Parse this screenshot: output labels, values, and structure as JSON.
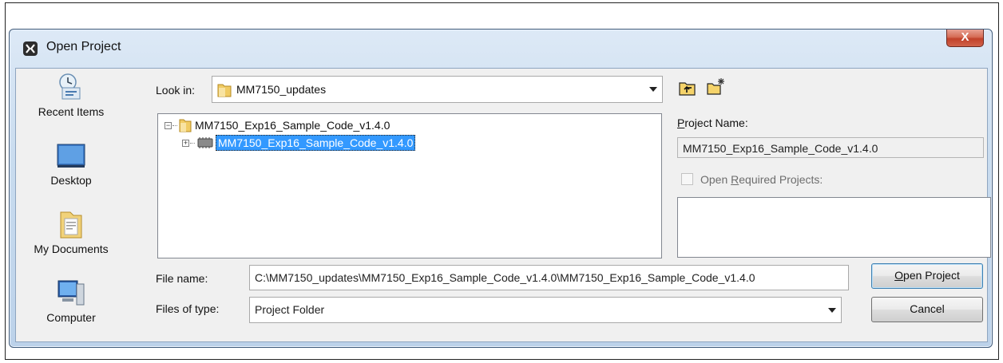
{
  "dialog": {
    "title": "Open Project",
    "close_glyph": "X",
    "accent_color": "#3399ff",
    "close_color": "#c1412a"
  },
  "places": [
    {
      "label": "Recent Items",
      "icon": "recent-items-icon"
    },
    {
      "label": "Desktop",
      "icon": "desktop-icon"
    },
    {
      "label": "My Documents",
      "icon": "my-documents-icon"
    },
    {
      "label": "Computer",
      "icon": "computer-icon"
    }
  ],
  "look_in": {
    "label": "Look in:",
    "value": "MM7150_updates"
  },
  "toolbar": {
    "up_folder_icon": "up-one-level-icon",
    "new_folder_icon": "new-folder-icon"
  },
  "tree": {
    "root": {
      "label": "MM7150_Exp16_Sample_Code_v1.4.0",
      "expander": "−"
    },
    "child": {
      "label": "MM7150_Exp16_Sample_Code_v1.4.0",
      "expander": "+",
      "selected": true
    }
  },
  "project_name": {
    "label_prefix": "P",
    "label_rest": "roject Name:",
    "value": "MM7150_Exp16_Sample_Code_v1.4.0"
  },
  "open_required": {
    "label_prefix": "Open ",
    "label_underlined": "R",
    "label_suffix": "equired Projects:",
    "checked": false
  },
  "file_name": {
    "label": "File name:",
    "value": "C:\\MM7150_updates\\MM7150_Exp16_Sample_Code_v1.4.0\\MM7150_Exp16_Sample_Code_v1.4.0"
  },
  "file_type": {
    "label": "Files of type:",
    "value": "Project Folder"
  },
  "buttons": {
    "open_underlined": "O",
    "open_rest": "pen Project",
    "cancel": "Cancel"
  }
}
